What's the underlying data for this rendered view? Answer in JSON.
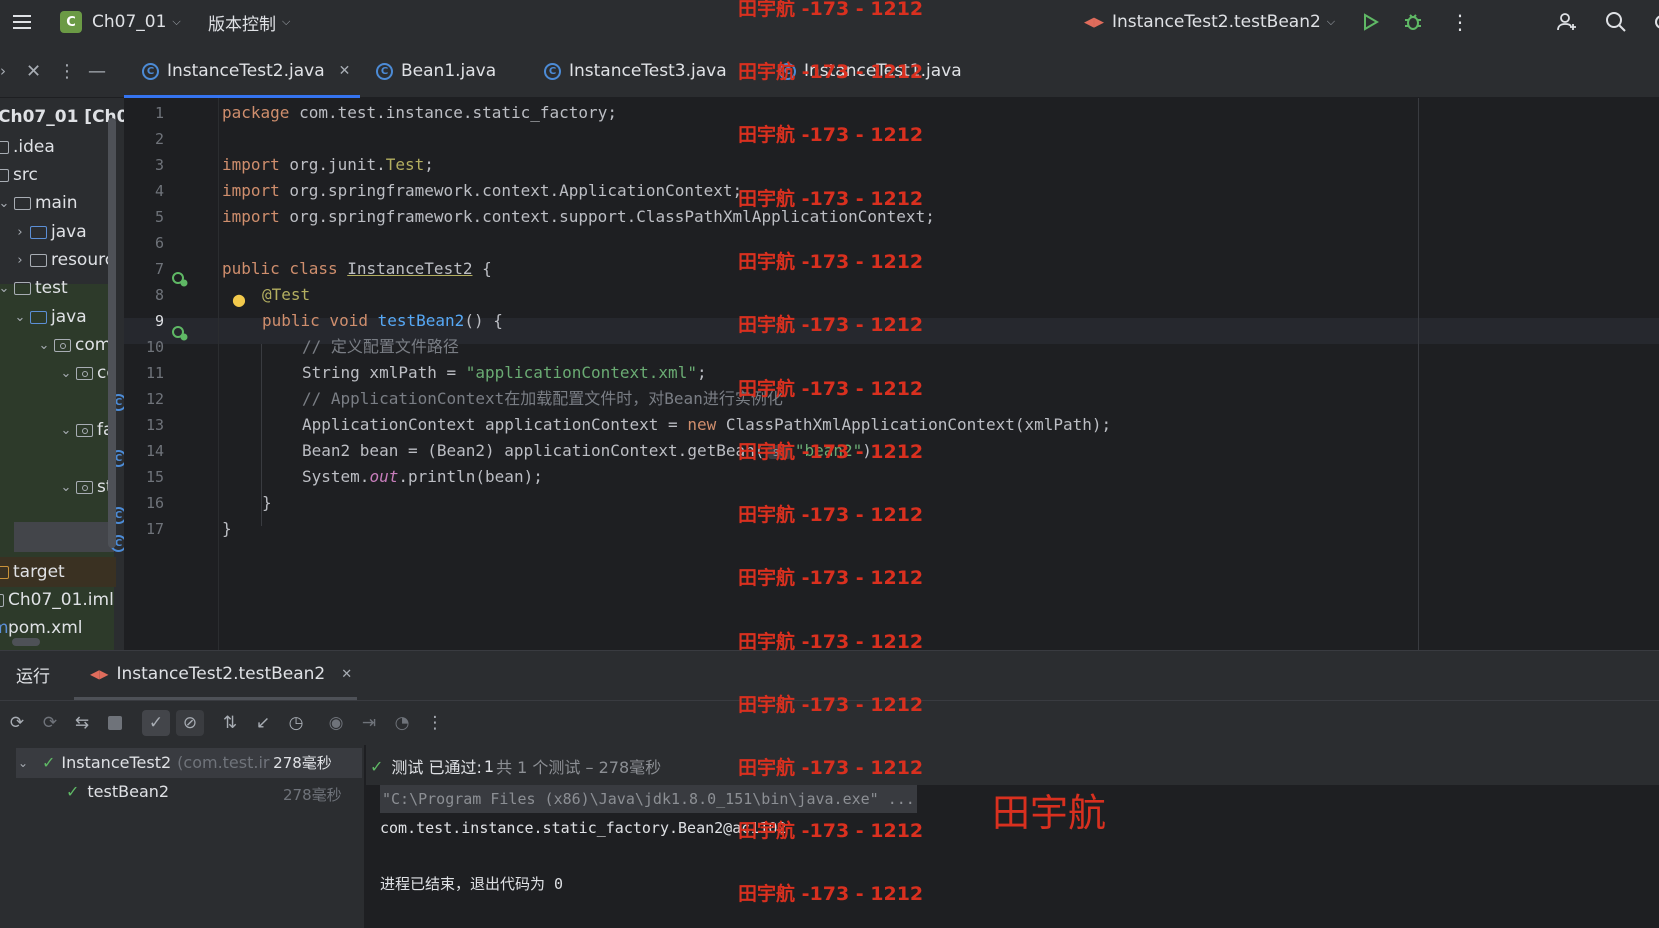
{
  "titlebar": {
    "project_badge": "C",
    "project_name": "Ch07_01",
    "vcs_menu": "版本控制",
    "run_config": "InstanceTest2.testBean2"
  },
  "tabs": [
    {
      "label": "InstanceTest2.java",
      "active": true
    },
    {
      "label": "Bean1.java"
    },
    {
      "label": "InstanceTest3.java"
    },
    {
      "label": "InstanceTest1.java"
    }
  ],
  "project_tree": {
    "root": "Ch07_01 [Ch07",
    "items": [
      ".idea",
      "src",
      "main",
      "java",
      "resourc",
      "test",
      "java",
      "com.",
      "co",
      "fa",
      "st",
      "target",
      "Ch07_01.iml",
      "pom.xml"
    ]
  },
  "editor": {
    "line_numbers": [
      "1",
      "2",
      "3",
      "4",
      "5",
      "6",
      "7",
      "8",
      "9",
      "10",
      "11",
      "12",
      "13",
      "14",
      "15",
      "16",
      "17"
    ],
    "lines": {
      "l1_kw": "package",
      "l1_rest": " com.test.instance.static_factory;",
      "l3_kw": "import",
      "l3_a": " org.junit.",
      "l3_b": "Test",
      "l3_c": ";",
      "l4_kw": "import",
      "l4_rest": " org.springframework.context.ApplicationContext;",
      "l5_kw": "import",
      "l5_rest": " org.springframework.context.support.ClassPathXmlApplicationContext;",
      "l7_kw": "public class",
      "l7_name": "InstanceTest2",
      "l7_rest": " {",
      "l8": "@Test",
      "l9_kw": "public void",
      "l9_fn": "testBean2",
      "l9_rest": "() {",
      "l10": "// 定义配置文件路径",
      "l11_a": "String xmlPath = ",
      "l11_str": "\"applicationContext.xml\"",
      "l11_b": ";",
      "l12": "// ApplicationContext在加载配置文件时，对Bean进行实例化",
      "l13_a": "ApplicationContext applicationContext = ",
      "l13_kw": "new",
      "l13_b": " ClassPathXmlApplicationContext(xmlPath);",
      "l14_a": "Bean2 bean = (Bean2) applicationContext.getBean(",
      "l14_hint": "s:",
      "l14_str": "\"bean2\"",
      "l14_b": ");",
      "l15_a": "System.",
      "l15_it": "out",
      "l15_b": ".println(bean);",
      "l16": "}",
      "l17": "}"
    }
  },
  "run_panel": {
    "title": "运行",
    "tab": "InstanceTest2.testBean2",
    "status_prefix": "测试 已通过:",
    "status_count": "1",
    "status_suffix": "共 1 个测试 – 278毫秒",
    "tree": [
      {
        "name": "InstanceTest2",
        "pkg": "(com.test.ir",
        "time": "278毫秒"
      },
      {
        "name": "testBean2",
        "time": "278毫秒"
      }
    ],
    "console": [
      "\"C:\\Program Files (x86)\\Java\\jdk1.8.0_151\\bin\\java.exe\" ...",
      "com.test.instance.static_factory.Bean2@ac1102",
      "",
      "进程已结束，退出代码为 0"
    ]
  },
  "watermark": {
    "small": "田宇航 -173 - 1212",
    "large": "田宇航"
  },
  "colors": {
    "accent": "#3574f0",
    "success": "#5fb865",
    "watermark": "#d9301f"
  }
}
